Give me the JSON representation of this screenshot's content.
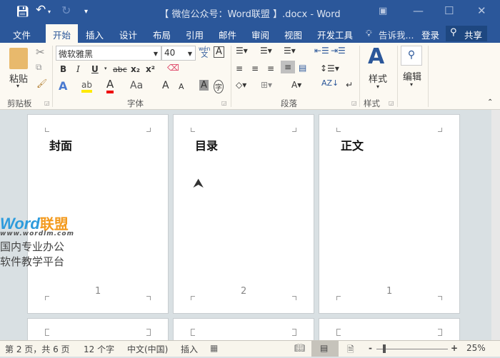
{
  "window": {
    "title": "【 微信公众号：Word联盟 】.docx - Word",
    "accent": "#2b579a"
  },
  "quick_access": {
    "save": "save-icon",
    "undo": "undo-icon",
    "redo": "redo-icon",
    "customize": "customize-icon"
  },
  "tabs": [
    {
      "label": "文件"
    },
    {
      "label": "开始",
      "active": true
    },
    {
      "label": "插入"
    },
    {
      "label": "设计"
    },
    {
      "label": "布局"
    },
    {
      "label": "引用"
    },
    {
      "label": "邮件"
    },
    {
      "label": "审阅"
    },
    {
      "label": "视图"
    },
    {
      "label": "开发工具"
    }
  ],
  "tell_me": "告诉我...",
  "login": "登录",
  "share": "共享",
  "ribbon": {
    "clipboard": {
      "paste": "粘贴",
      "group": "剪贴板"
    },
    "font": {
      "name": "微软雅黑",
      "size": "40",
      "group": "字体",
      "bold": "B",
      "italic": "I",
      "underline": "U",
      "strike": "abc",
      "sub": "x₂",
      "sup": "x²",
      "case": "Aa",
      "grow": "A",
      "shrink": "A",
      "shade": "A",
      "circle": "字",
      "phonetic": "wén",
      "phonetic2": "文",
      "border": "A",
      "effects": "A",
      "color": "A"
    },
    "paragraph": {
      "group": "段落"
    },
    "styles": {
      "label": "样式",
      "group": "样式"
    },
    "editing": {
      "label": "编辑"
    }
  },
  "pages": [
    {
      "title": "封面",
      "number": "1"
    },
    {
      "title": "目录",
      "number": "2"
    },
    {
      "title": "正文",
      "number": "1"
    }
  ],
  "watermark": {
    "brand1": "Word",
    "brand2": "联盟",
    "url": "www.wordlm.com",
    "line1": "国内专业办公",
    "line2": "软件教学平台"
  },
  "status": {
    "page": "第 2 页，共 6 页",
    "words": "12 个字",
    "language": "中文(中国)",
    "mode": "插入",
    "zoom": "25%",
    "zoom_percent": 25
  }
}
